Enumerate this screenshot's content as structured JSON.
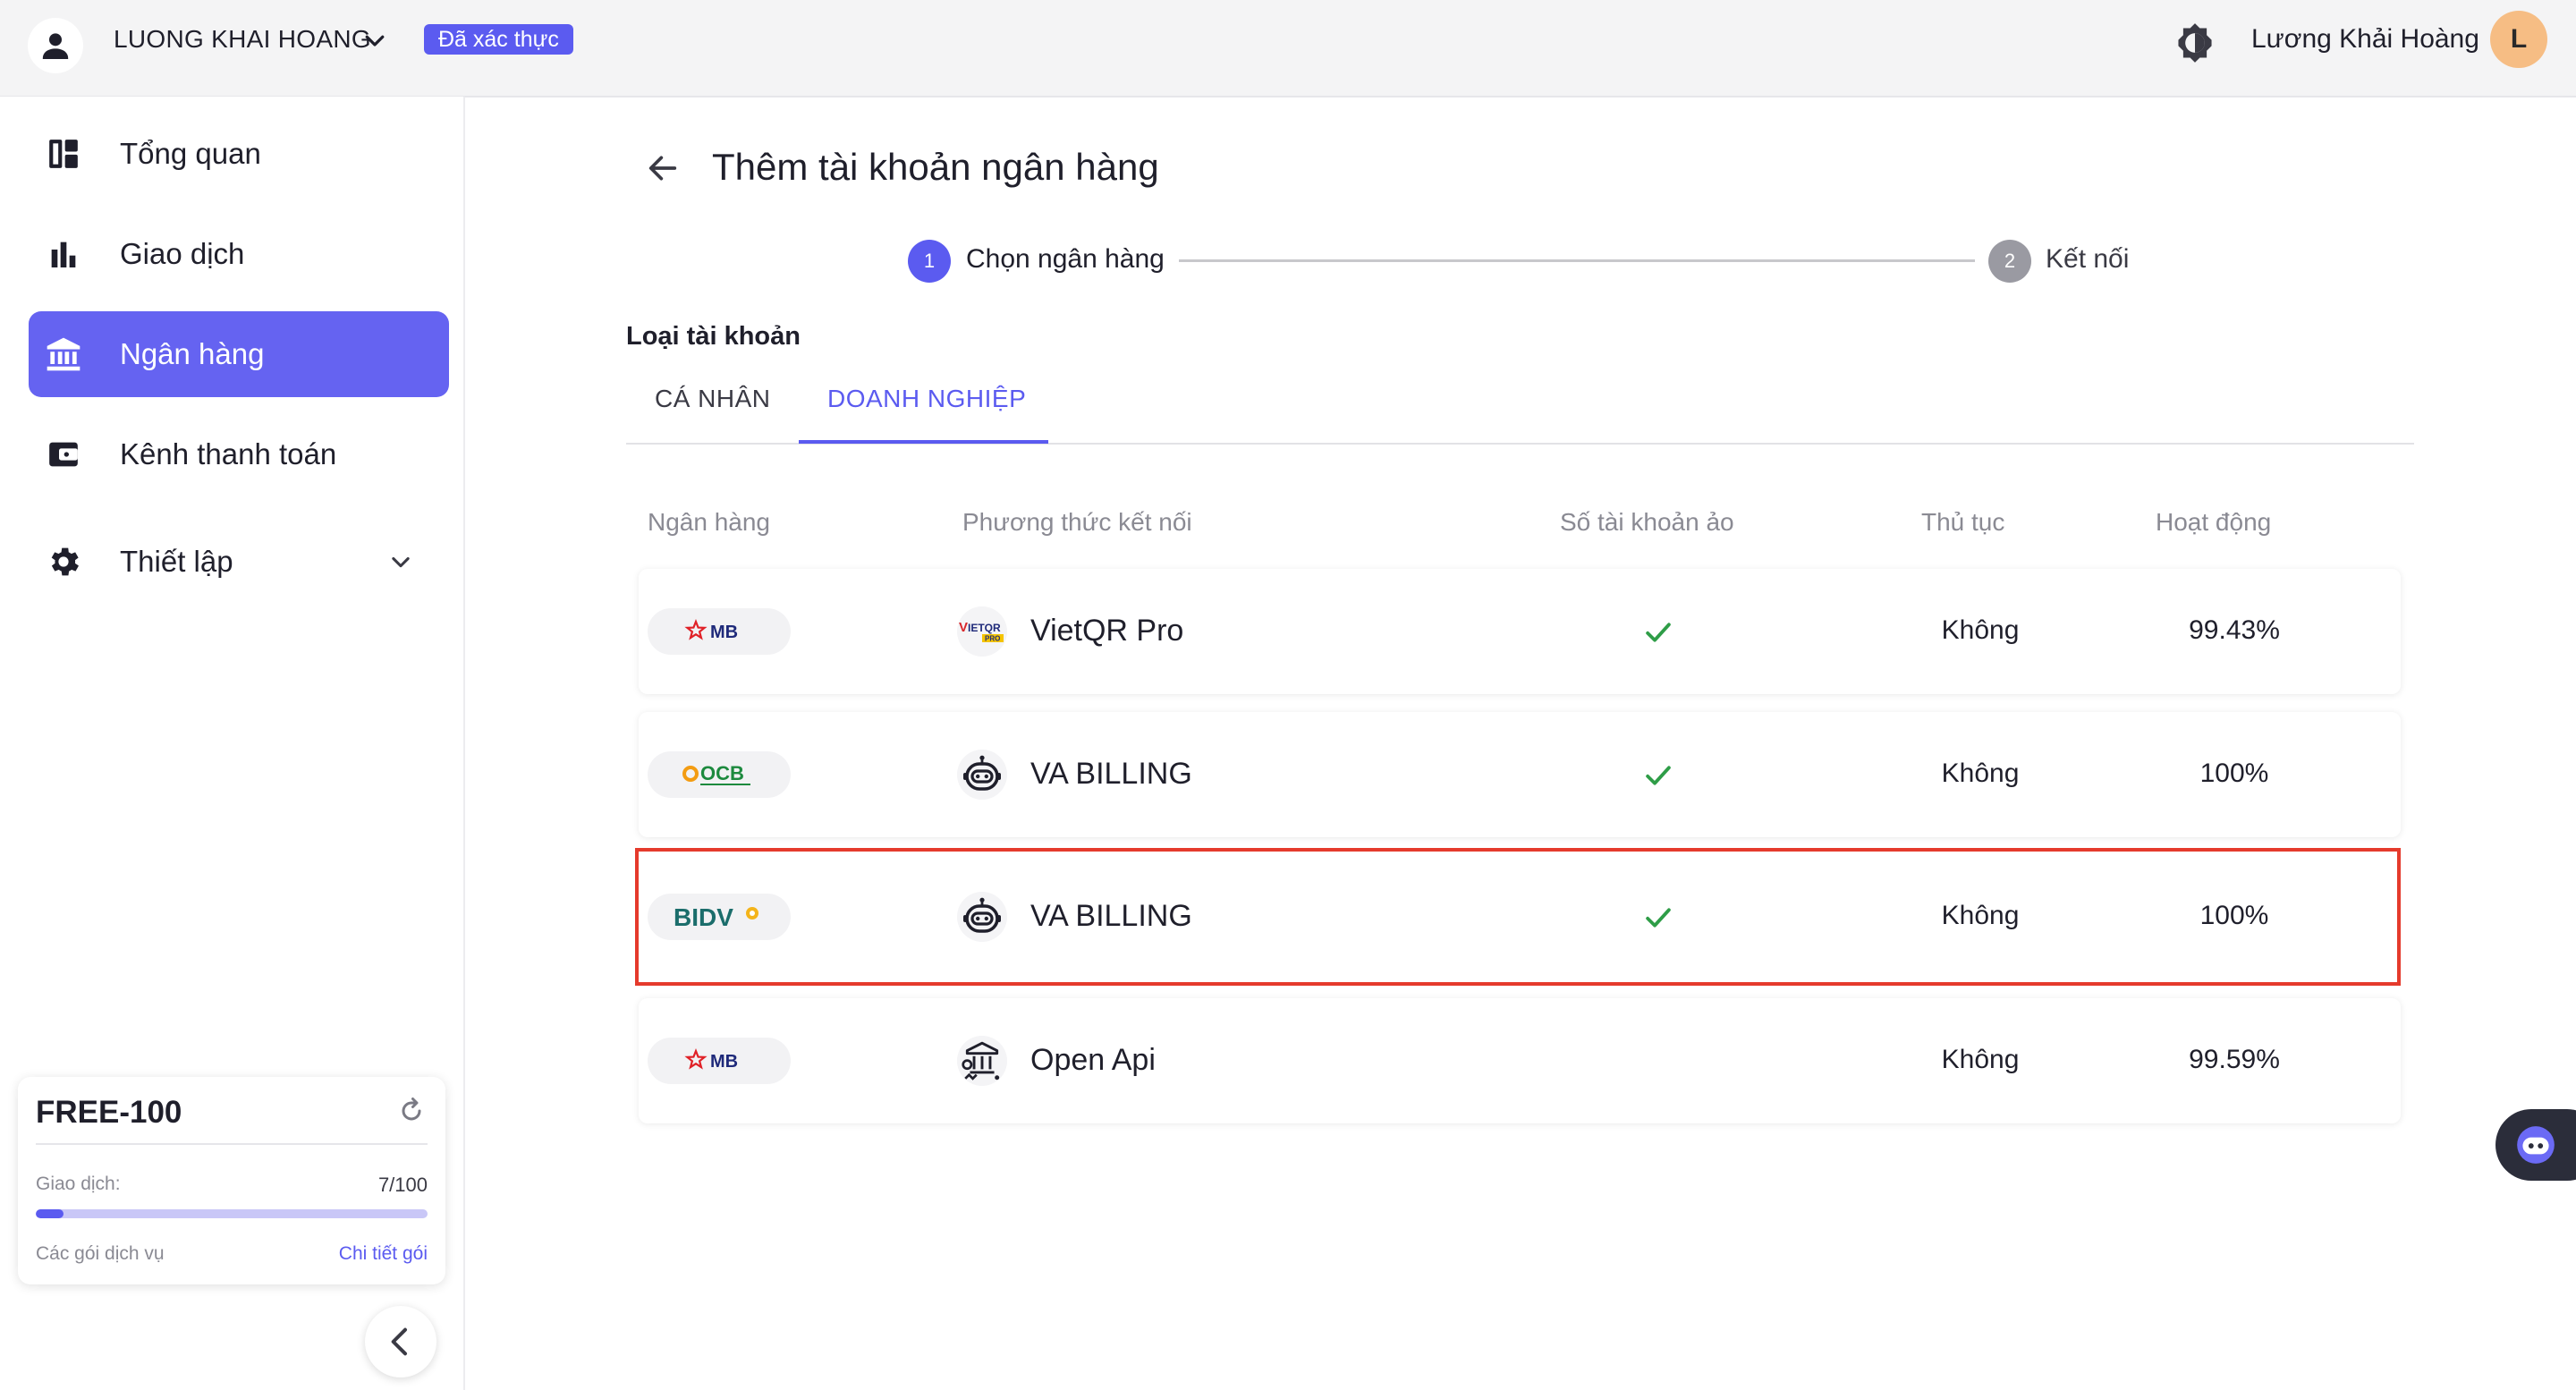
{
  "topbar": {
    "account_name": "LUONG KHAI HOANG",
    "verified_badge": "Đã xác thực",
    "user_fullname": "Lương Khải Hoàng",
    "avatar_initial": "L"
  },
  "sidebar": {
    "items": [
      {
        "label": "Tổng quan",
        "icon": "dashboard-icon"
      },
      {
        "label": "Giao dịch",
        "icon": "bar-chart-icon"
      },
      {
        "label": "Ngân hàng",
        "icon": "bank-icon",
        "active": true
      },
      {
        "label": "Kênh thanh toán",
        "icon": "wallet-icon"
      },
      {
        "label": "Thiết lập",
        "icon": "gear-icon",
        "expandable": true
      }
    ],
    "plan": {
      "name": "FREE-100",
      "transactions_label": "Giao dịch:",
      "transactions_value": "7/100",
      "transactions_used": 7,
      "transactions_limit": 100,
      "packages_label": "Các gói dịch vụ",
      "details_link": "Chi tiết gói"
    }
  },
  "page": {
    "title": "Thêm tài khoản ngân hàng",
    "steps": [
      {
        "number": "1",
        "label": "Chọn ngân hàng",
        "active": true
      },
      {
        "number": "2",
        "label": "Kết nối",
        "active": false
      }
    ],
    "account_type_label": "Loại tài khoản",
    "tabs": [
      {
        "label": "CÁ NHÂN",
        "selected": false
      },
      {
        "label": "DOANH NGHIỆP",
        "selected": true
      }
    ]
  },
  "table": {
    "headers": [
      "Ngân hàng",
      "Phương thức kết nối",
      "Số tài khoản ảo",
      "Thủ tục",
      "Hoạt động"
    ],
    "rows": [
      {
        "bank": "MB",
        "method": "VietQR Pro",
        "method_icon": "vietqr-pro-logo",
        "virtual_account": true,
        "procedure": "Không",
        "uptime": "99.43%",
        "highlighted": false
      },
      {
        "bank": "OCB",
        "method": "VA BILLING",
        "method_icon": "robot-icon",
        "virtual_account": true,
        "procedure": "Không",
        "uptime": "100%",
        "highlighted": false
      },
      {
        "bank": "BIDV",
        "method": "VA BILLING",
        "method_icon": "robot-icon",
        "virtual_account": true,
        "procedure": "Không",
        "uptime": "100%",
        "highlighted": true
      },
      {
        "bank": "MB",
        "method": "Open Api",
        "method_icon": "bank-api-icon",
        "virtual_account": false,
        "procedure": "Không",
        "uptime": "99.59%",
        "highlighted": false
      }
    ]
  },
  "colors": {
    "accent": "#5b5bf0",
    "highlight_border": "#e53a2c",
    "check": "#2e9d47"
  }
}
